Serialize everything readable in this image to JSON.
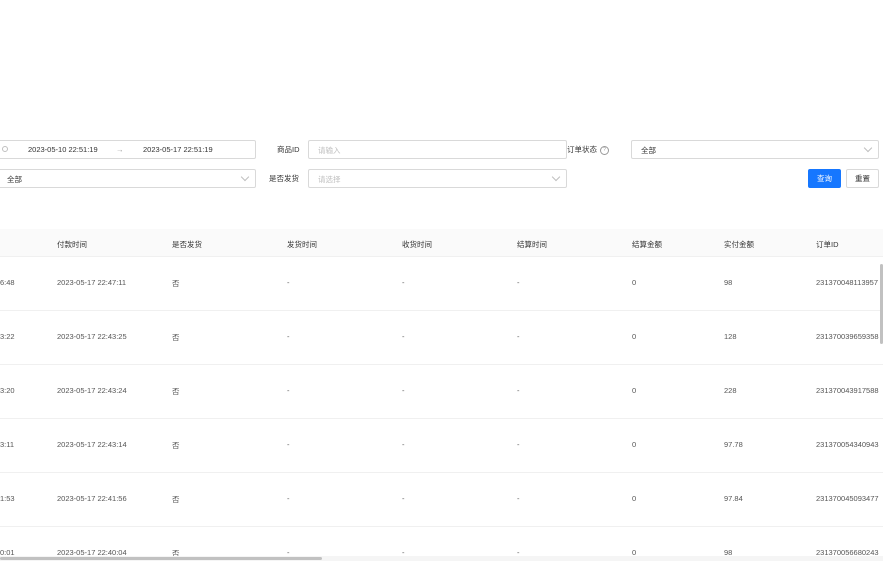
{
  "filters": {
    "date_range": {
      "start": "2023-05-10 22:51:19",
      "separator": "→",
      "end": "2023-05-17 22:51:19"
    },
    "product_id": {
      "label": "商品ID",
      "placeholder": "请输入"
    },
    "order_status": {
      "label": "订单状态",
      "help_icon": "question-circle-icon",
      "value": "全部"
    },
    "left_select": {
      "value": "全部"
    },
    "shipped": {
      "label": "是否发货",
      "placeholder": "请选择"
    },
    "query_label": "查询",
    "reset_label": "重置"
  },
  "table": {
    "columns": [
      "付款时间",
      "是否发货",
      "发货时间",
      "收货时间",
      "结算时间",
      "结算金额",
      "实付金额",
      "订单ID"
    ],
    "rows": [
      {
        "prev": "6:48",
        "paid": "2023-05-17 22:47:11",
        "shipped": "否",
        "ship_time": "-",
        "recv_time": "-",
        "settle_time": "-",
        "settle_amt": "0",
        "paid_amt": "98",
        "order_id": "231370048113957"
      },
      {
        "prev": "3:22",
        "paid": "2023-05-17 22:43:25",
        "shipped": "否",
        "ship_time": "-",
        "recv_time": "-",
        "settle_time": "-",
        "settle_amt": "0",
        "paid_amt": "128",
        "order_id": "231370039659358"
      },
      {
        "prev": "3:20",
        "paid": "2023-05-17 22:43:24",
        "shipped": "否",
        "ship_time": "-",
        "recv_time": "-",
        "settle_time": "-",
        "settle_amt": "0",
        "paid_amt": "228",
        "order_id": "231370043917588"
      },
      {
        "prev": "3:11",
        "paid": "2023-05-17 22:43:14",
        "shipped": "否",
        "ship_time": "-",
        "recv_time": "-",
        "settle_time": "-",
        "settle_amt": "0",
        "paid_amt": "97.78",
        "order_id": "231370054340943"
      },
      {
        "prev": "1:53",
        "paid": "2023-05-17 22:41:56",
        "shipped": "否",
        "ship_time": "-",
        "recv_time": "-",
        "settle_time": "-",
        "settle_amt": "0",
        "paid_amt": "97.84",
        "order_id": "231370045093477"
      },
      {
        "prev": "0:01",
        "paid": "2023-05-17 22:40:04",
        "shipped": "否",
        "ship_time": "-",
        "recv_time": "-",
        "settle_time": "-",
        "settle_amt": "0",
        "paid_amt": "98",
        "order_id": "231370056680243"
      }
    ]
  },
  "colors": {
    "primary": "#1677ff",
    "header_bg": "#fafafa",
    "border": "#d9d9d9"
  }
}
